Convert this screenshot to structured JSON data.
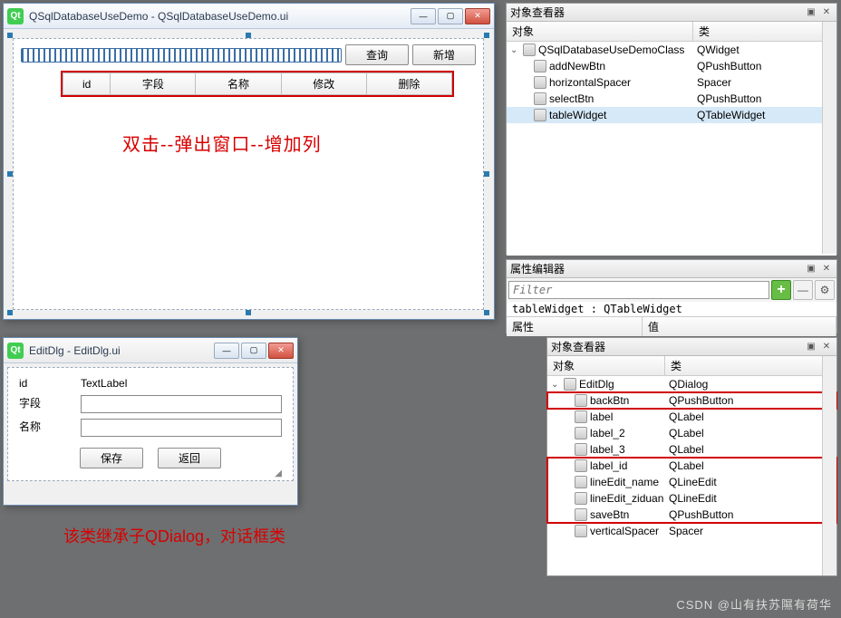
{
  "main_window": {
    "title": "QSqlDatabaseUseDemo - QSqlDatabaseUseDemo.ui",
    "buttons": {
      "query": "查询",
      "add": "新增"
    },
    "table_headers": [
      "id",
      "字段",
      "名称",
      "修改",
      "删除"
    ],
    "annotation": "双击--弹出窗口--增加列"
  },
  "object_inspector1": {
    "title": "对象查看器",
    "cols": {
      "object": "对象",
      "class": "类"
    },
    "root": {
      "name": "QSqlDatabaseUseDemoClass",
      "cls": "QWidget"
    },
    "children": [
      {
        "name": "addNewBtn",
        "cls": "QPushButton"
      },
      {
        "name": "horizontalSpacer",
        "cls": "Spacer"
      },
      {
        "name": "selectBtn",
        "cls": "QPushButton"
      },
      {
        "name": "tableWidget",
        "cls": "QTableWidget",
        "selected": true
      }
    ]
  },
  "property_editor": {
    "title": "属性编辑器",
    "filter_placeholder": "Filter",
    "crumb": "tableWidget : QTableWidget",
    "cols": {
      "prop": "属性",
      "value": "值"
    }
  },
  "edit_dlg": {
    "title": "EditDlg - EditDlg.ui",
    "rows": {
      "id_label": "id",
      "id_value": "TextLabel",
      "f2": "字段",
      "f3": "名称"
    },
    "buttons": {
      "save": "保存",
      "back": "返回"
    }
  },
  "object_inspector2": {
    "title": "对象查看器",
    "cols": {
      "object": "对象",
      "class": "类"
    },
    "root": {
      "name": "EditDlg",
      "cls": "QDialog"
    },
    "children": [
      {
        "name": "backBtn",
        "cls": "QPushButton",
        "boxed": true
      },
      {
        "name": "label",
        "cls": "QLabel"
      },
      {
        "name": "label_2",
        "cls": "QLabel"
      },
      {
        "name": "label_3",
        "cls": "QLabel"
      },
      {
        "name": "label_id",
        "cls": "QLabel",
        "boxed_group_start": true
      },
      {
        "name": "lineEdit_name",
        "cls": "QLineEdit"
      },
      {
        "name": "lineEdit_ziduan",
        "cls": "QLineEdit"
      },
      {
        "name": "saveBtn",
        "cls": "QPushButton",
        "boxed_group_end": true
      },
      {
        "name": "verticalSpacer",
        "cls": "Spacer"
      }
    ]
  },
  "annotation2": "该类继承子QDialog，对话框类",
  "watermark": "CSDN @山有扶苏隰有荷华"
}
